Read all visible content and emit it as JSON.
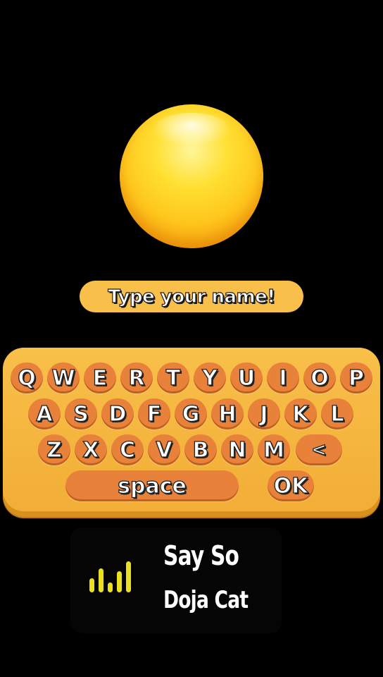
{
  "prompt": {
    "text": "Type your name!"
  },
  "keyboard": {
    "row1": [
      "Q",
      "W",
      "E",
      "R",
      "T",
      "Y",
      "U",
      "I",
      "O",
      "P"
    ],
    "row2": [
      "A",
      "S",
      "D",
      "F",
      "G",
      "H",
      "J",
      "K",
      "L"
    ],
    "row3": [
      "Z",
      "X",
      "C",
      "V",
      "B",
      "N",
      "M"
    ],
    "backspace_label": "<",
    "space_label": "space",
    "ok_label": "OK"
  },
  "now_playing": {
    "title": "Say So",
    "artist": "Doja Cat"
  },
  "colors": {
    "background": "#000000",
    "keyboard": "#f8c04a",
    "key": "#e8823a",
    "orb": "#ffc81e",
    "bars": "#e8e021"
  }
}
